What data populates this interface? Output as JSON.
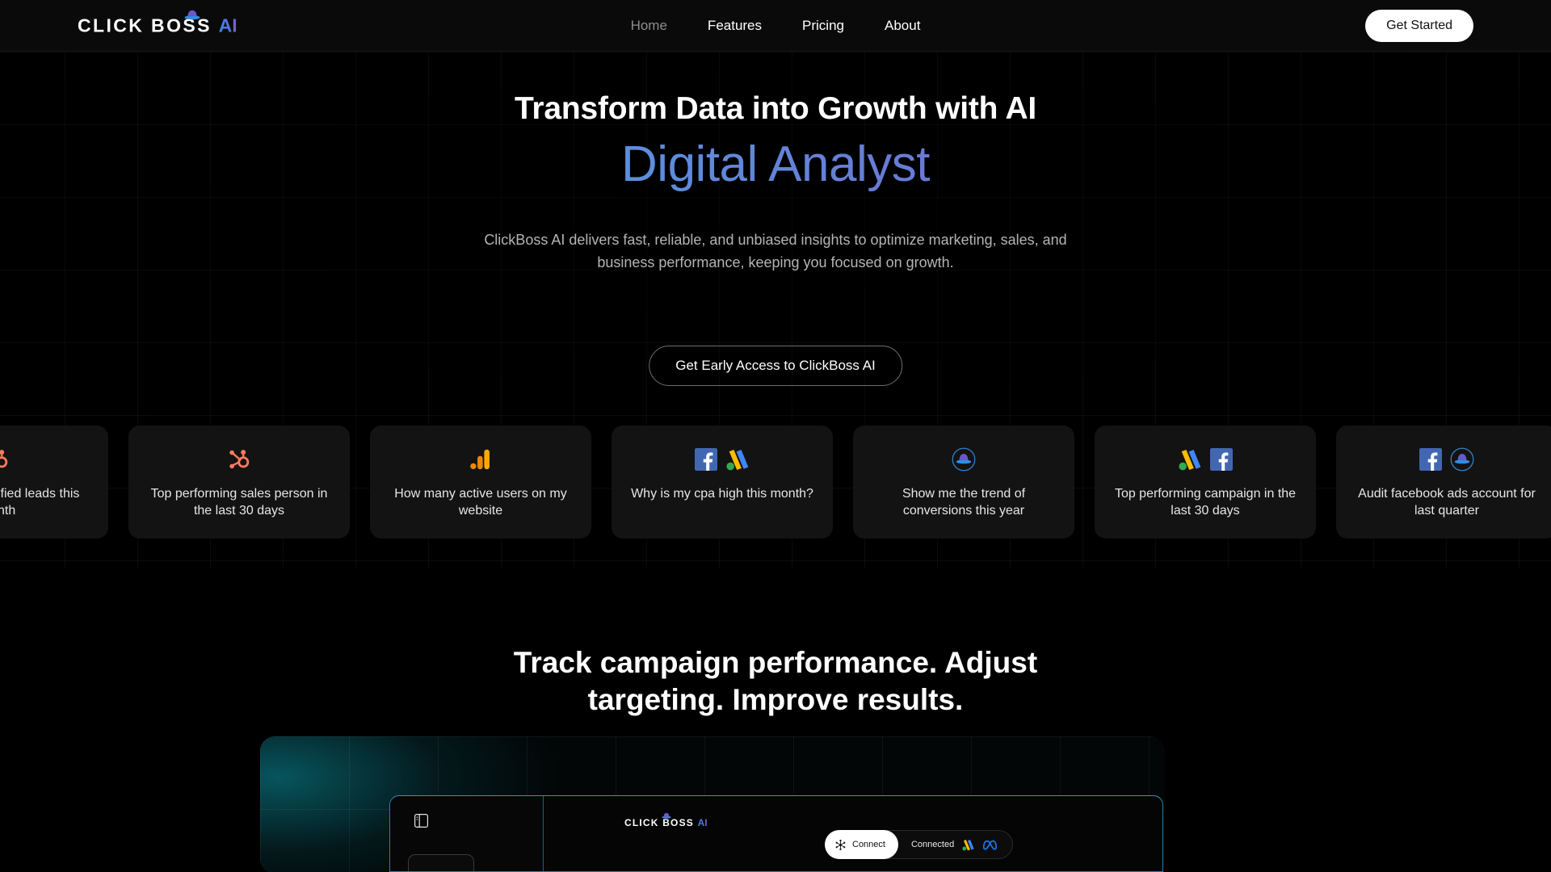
{
  "header": {
    "logo": {
      "text_main": "CLICK BOSS",
      "text_ai": "AI",
      "hat_icon": "hat-icon"
    },
    "nav": [
      {
        "label": "Home",
        "active": true
      },
      {
        "label": "Features",
        "active": false
      },
      {
        "label": "Pricing",
        "active": false
      },
      {
        "label": "About",
        "active": false
      }
    ],
    "cta_label": "Get Started"
  },
  "hero": {
    "eyebrow_heading": "Transform Data into Growth with AI",
    "gradient_heading": "Digital Analyst",
    "subtitle": "ClickBoss AI delivers fast, reliable, and unbiased insights to optimize marketing, sales, and business performance, keeping you focused on growth.",
    "cta_label": "Get Early Access to ClickBoss AI",
    "gradient_start": "#4aa8e8",
    "gradient_end": "#7d54bd"
  },
  "prompt_cards": [
    {
      "text": "Show me qualified leads this month",
      "icons": [
        "hubspot-icon"
      ]
    },
    {
      "text": "Top performing sales person in the last 30 days",
      "icons": [
        "hubspot-icon"
      ]
    },
    {
      "text": "How many active users on my website",
      "icons": [
        "google-analytics-icon"
      ]
    },
    {
      "text": "Why is my cpa high this month?",
      "icons": [
        "facebook-icon",
        "google-ads-icon"
      ]
    },
    {
      "text": "Show me the trend of conversions this year",
      "icons": [
        "clickboss-hat-icon"
      ]
    },
    {
      "text": "Top performing campaign in the last 30 days",
      "icons": [
        "google-ads-icon",
        "facebook-icon"
      ]
    },
    {
      "text": "Audit facebook ads account for last quarter",
      "icons": [
        "facebook-icon",
        "clickboss-hat-icon"
      ]
    }
  ],
  "section_two": {
    "title": "Track campaign performance. Adjust targeting. Improve results."
  },
  "dashboard_mockup": {
    "logo_main": "CLICK BOSS",
    "logo_ai": "AI",
    "connect_label": "Connect",
    "connected_label": "Connected",
    "connected_icons": [
      "google-ads-icon",
      "meta-icon"
    ],
    "sidebar_icon": "panel-toggle-icon"
  }
}
